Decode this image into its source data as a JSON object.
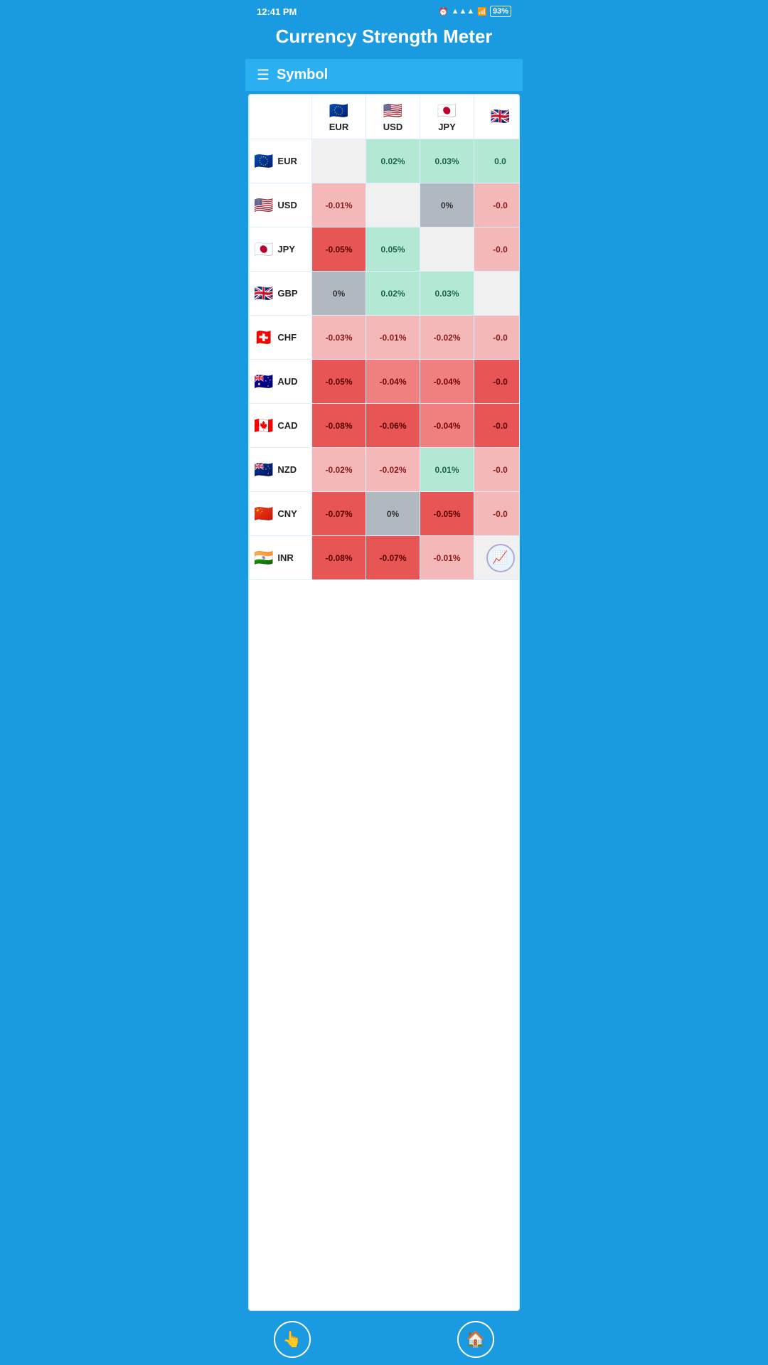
{
  "statusBar": {
    "time": "12:41 PM",
    "battery": "93"
  },
  "header": {
    "title": "Currency Strength Meter"
  },
  "symbolBar": {
    "label": "Symbol",
    "menuIcon": "☰"
  },
  "columns": [
    "EUR",
    "USD",
    "JPY",
    "GBP"
  ],
  "currencies": [
    {
      "code": "EUR",
      "flag": "🇪🇺",
      "values": {
        "EUR": null,
        "USD": "0.02%",
        "JPY": "0.03%",
        "GBP": "0.0..."
      },
      "cellTypes": {
        "EUR": "diagonal",
        "USD": "positive-light",
        "JPY": "positive-light",
        "GBP": "positive-light"
      }
    },
    {
      "code": "USD",
      "flag": "🇺🇸",
      "values": {
        "EUR": "-0.01%",
        "USD": null,
        "JPY": "0%",
        "GBP": "-0.0..."
      },
      "cellTypes": {
        "EUR": "negative-light",
        "USD": "diagonal",
        "JPY": "zero",
        "GBP": "negative-light"
      }
    },
    {
      "code": "JPY",
      "flag": "🇯🇵",
      "values": {
        "EUR": "-0.05%",
        "USD": "0.05%",
        "JPY": null,
        "GBP": "-0.0..."
      },
      "cellTypes": {
        "EUR": "negative-dark",
        "USD": "positive-light",
        "JPY": "diagonal",
        "GBP": "negative-light"
      }
    },
    {
      "code": "GBP",
      "flag": "🇬🇧",
      "values": {
        "EUR": "0%",
        "USD": "0.02%",
        "JPY": "0.03%",
        "GBP": null
      },
      "cellTypes": {
        "EUR": "zero",
        "USD": "positive-light",
        "JPY": "positive-light",
        "GBP": "diagonal"
      }
    },
    {
      "code": "CHF",
      "flag": "🇨🇭",
      "values": {
        "EUR": "-0.03%",
        "USD": "-0.01%",
        "JPY": "-0.02%",
        "GBP": "-0.0..."
      },
      "cellTypes": {
        "EUR": "negative-light",
        "USD": "negative-light",
        "JPY": "negative-light",
        "GBP": "negative-light"
      }
    },
    {
      "code": "AUD",
      "flag": "🇦🇺",
      "values": {
        "EUR": "-0.05%",
        "USD": "-0.04%",
        "JPY": "-0.04%",
        "GBP": "-0.0..."
      },
      "cellTypes": {
        "EUR": "negative-dark",
        "USD": "negative-medium",
        "JPY": "negative-medium",
        "GBP": "negative-dark"
      }
    },
    {
      "code": "CAD",
      "flag": "🇨🇦",
      "values": {
        "EUR": "-0.08%",
        "USD": "-0.06%",
        "JPY": "-0.04%",
        "GBP": "-0.0..."
      },
      "cellTypes": {
        "EUR": "negative-dark",
        "USD": "negative-dark",
        "JPY": "negative-medium",
        "GBP": "negative-dark"
      }
    },
    {
      "code": "NZD",
      "flag": "🇳🇿",
      "values": {
        "EUR": "-0.02%",
        "USD": "-0.02%",
        "JPY": "0.01%",
        "GBP": "-0.0..."
      },
      "cellTypes": {
        "EUR": "negative-light",
        "USD": "negative-light",
        "JPY": "positive-light",
        "GBP": "negative-light"
      }
    },
    {
      "code": "CNY",
      "flag": "🇨🇳",
      "values": {
        "EUR": "-0.07%",
        "USD": "0%",
        "JPY": "-0.05%",
        "GBP": "-0.0..."
      },
      "cellTypes": {
        "EUR": "negative-dark",
        "USD": "zero",
        "JPY": "negative-dark",
        "GBP": "negative-light"
      }
    },
    {
      "code": "INR",
      "flag": "🇮🇳",
      "values": {
        "EUR": "-0.08%",
        "USD": "-0.07%",
        "JPY": "-0.01%",
        "GBP": null
      },
      "cellTypes": {
        "EUR": "negative-dark",
        "USD": "negative-dark",
        "JPY": "negative-light",
        "GBP": "chart"
      }
    }
  ],
  "footer": {
    "leftBtn": "👆",
    "rightBtn": "🏠"
  }
}
